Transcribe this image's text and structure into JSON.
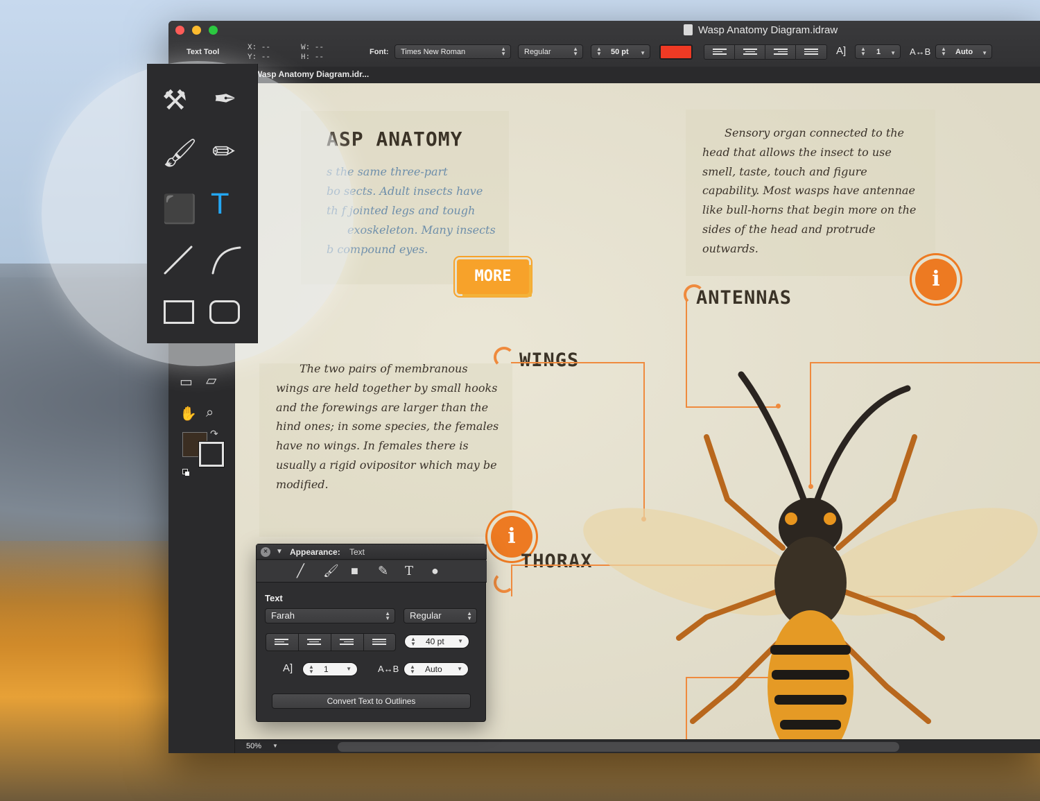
{
  "window": {
    "title": "Wasp Anatomy Diagram.idraw",
    "tab": "Wasp Anatomy Diagram.idr..."
  },
  "toolbar": {
    "tool_name": "Text Tool",
    "x_label": "X: --",
    "y_label": "Y: --",
    "w_label": "W: --",
    "h_label": "H: --",
    "font_label": "Font:",
    "font_family": "Times New Roman",
    "font_style": "Regular",
    "font_size": "50 pt",
    "text_color": "#ef3a24",
    "line_spacing_icon": "A]",
    "line_spacing": "1",
    "kerning_icon": "A↔B",
    "kerning": "Auto"
  },
  "sidebar": {
    "icons": [
      "node-icon",
      "pen-icon",
      "brush-icon",
      "pencil-icon",
      "eraser-icon",
      "text-tool-icon",
      "line-icon",
      "arc-icon",
      "rectangle-icon",
      "rounded-rectangle-icon",
      "frame-icon",
      "skew-icon",
      "hand-icon",
      "zoom-icon"
    ],
    "fill_color": "#3b2e22"
  },
  "canvas": {
    "intro_heading": "ASP ANATOMY",
    "intro_text": [
      "s the same three-part",
      "bo  sects. Adult insects have",
      "th f jointed legs and tough",
      "exoskeleton. Many insects",
      "b compound eyes."
    ],
    "more_button": "MORE",
    "antennas_text": [
      "Sensory organ connected to the",
      "head that allows the insect to use",
      "smell, taste, touch and figure",
      "capability. Most wasps have antennae",
      "like bull-horns that begin more on the",
      "sides of the head and protrude",
      "outwards."
    ],
    "antennas_heading": "ANTENNAS",
    "wings_heading": "WINGS",
    "wings_text": [
      "The two pairs of membranous",
      "wings are held together by small hooks",
      "and the forewings are larger than the",
      "hind ones; in some species, the females",
      "have no wings. In females there is",
      "usually a rigid ovipositor which may be",
      "modified."
    ],
    "thorax_heading": "THORAX",
    "info_glyph": "i",
    "accent_color": "#ef8a3d"
  },
  "statusbar": {
    "zoom": "50%"
  },
  "appearance_panel": {
    "title": "Appearance:",
    "subtitle": "Text",
    "section": "Text",
    "font_family": "Farah",
    "font_style": "Regular",
    "font_size": "40 pt",
    "line_spacing_icon": "A]",
    "line_spacing": "1",
    "kerning_icon": "A↔B",
    "kerning": "Auto",
    "convert_button": "Convert Text to Outlines"
  }
}
